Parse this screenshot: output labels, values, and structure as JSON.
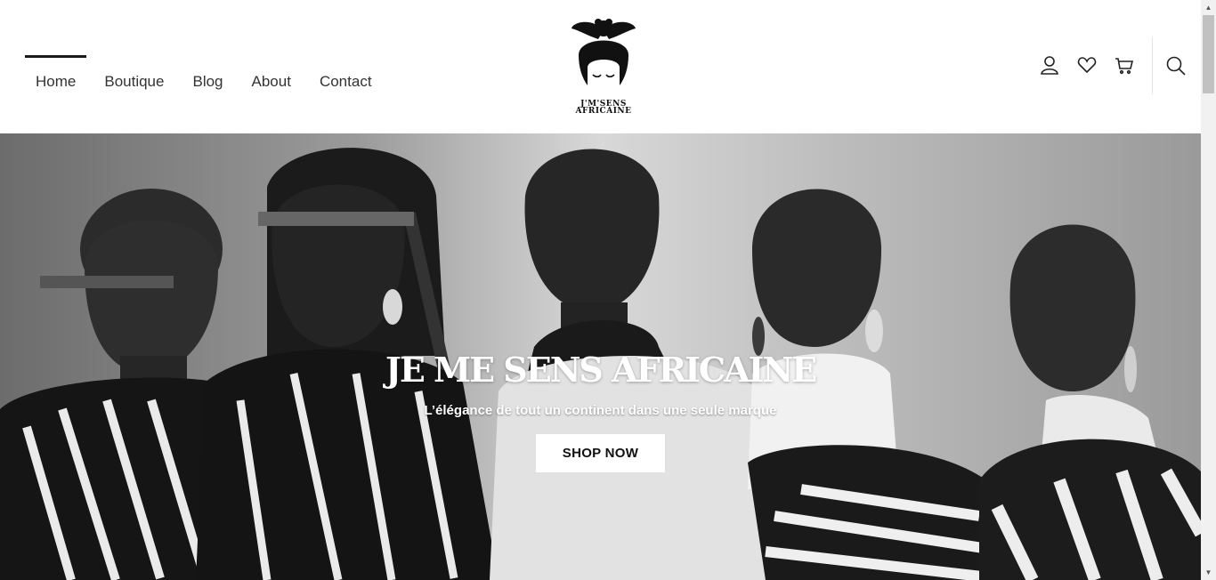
{
  "nav": {
    "items": [
      {
        "label": "Home",
        "active": true
      },
      {
        "label": "Boutique",
        "active": false
      },
      {
        "label": "Blog",
        "active": false
      },
      {
        "label": "About",
        "active": false
      },
      {
        "label": "Contact",
        "active": false
      }
    ]
  },
  "logo": {
    "line1": "J'M'SENS",
    "line2": "AFRICAINE"
  },
  "header_icons": [
    "user-icon",
    "heart-icon",
    "cart-icon",
    "search-icon"
  ],
  "hero": {
    "title": "JE ME SENS AFRICAINE",
    "subtitle": "L’élégance de tout un continent dans une seule marque",
    "cta_label": "SHOP NOW"
  },
  "colors": {
    "text": "#222222",
    "accent": "#1a1a1a",
    "hero_text": "#ffffff"
  }
}
